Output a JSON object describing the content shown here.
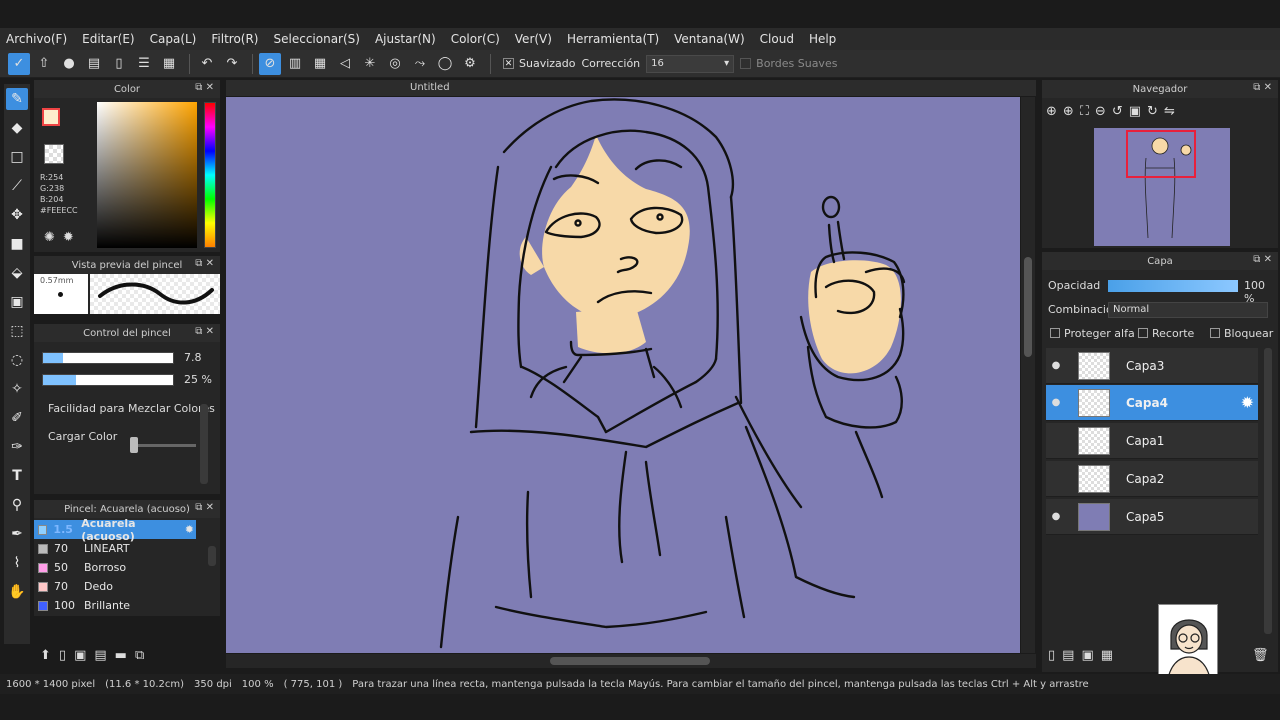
{
  "menu": [
    "Archivo(F)",
    "Editar(E)",
    "Capa(L)",
    "Filtro(R)",
    "Seleccionar(S)",
    "Ajustar(N)",
    "Color(C)",
    "Ver(V)",
    "Herramienta(T)",
    "Ventana(W)",
    "Cloud",
    "Help"
  ],
  "toolbar": {
    "smoothing_label": "Suavizado",
    "correction_label": "Corrección",
    "correction_value": "16",
    "soft_edges_label": "Bordes Suaves"
  },
  "color_panel": {
    "title": "Color",
    "r": "R:254",
    "g": "G:238",
    "b": "B:204",
    "hex": "#FEEECC",
    "foreground": "#feeecc"
  },
  "brush_preview": {
    "title": "Vista previa del pincel",
    "size": "0.57mm"
  },
  "brush_control": {
    "title": "Control del pincel",
    "size_value": "7.8",
    "size_fraction": 0.15,
    "opacity_value": "25 %",
    "opacity_fraction": 0.25,
    "mix_label": "Facilidad para Mezclar Colores",
    "load_label": "Cargar Color"
  },
  "brush_list": {
    "title": "Pincel: Acuarela (acuoso)",
    "items": [
      {
        "num": "1.5",
        "name": "Acuarela (acuoso)",
        "color": "#8fd0ff"
      },
      {
        "num": "70",
        "name": "LINEART",
        "color": "#bbbbbb"
      },
      {
        "num": "50",
        "name": "Borroso",
        "color": "#ff9ee8"
      },
      {
        "num": "70",
        "name": "Dedo",
        "color": "#ffc8c8"
      },
      {
        "num": "100",
        "name": "Brillante",
        "color": "#4060ff"
      }
    ]
  },
  "canvas": {
    "title": "Untitled",
    "background": "#7f7db4"
  },
  "navigator": {
    "title": "Navegador"
  },
  "layers": {
    "title": "Capa",
    "opacity_label": "Opacidad",
    "opacity_value": "100 %",
    "blend_label": "Combinación",
    "blend_value": "Normal",
    "protect_alpha": "Proteger alfa",
    "clip": "Recorte",
    "lock": "Bloquear",
    "items": [
      {
        "name": "Capa3"
      },
      {
        "name": "Capa4"
      },
      {
        "name": "Capa1"
      },
      {
        "name": "Capa2"
      },
      {
        "name": "Capa5"
      }
    ]
  },
  "status": {
    "dimensions": "1600 * 1400 pixel",
    "physical": "(11.6 * 10.2cm)",
    "dpi": "350 dpi",
    "zoom": "100 %",
    "coords": "( 775, 101 )",
    "hint": "Para trazar una línea recta, mantenga pulsada la tecla Mayús. Para cambiar el tamaño del pincel, mantenga pulsada las teclas Ctrl + Alt y arrastre"
  }
}
